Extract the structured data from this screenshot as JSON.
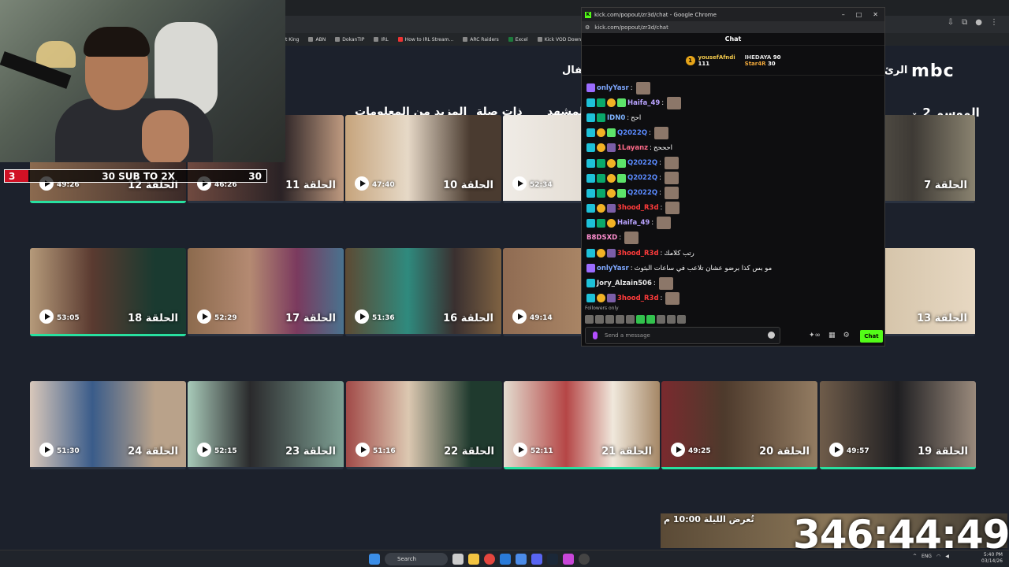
{
  "browser": {
    "bookmarks": [
      "t King",
      "ABN",
      "DokanTIP",
      "IRL",
      "How to IRL Stream...",
      "ARC Raiders",
      "Excel",
      "Kick VOD Download..."
    ]
  },
  "site": {
    "logo": "mbc",
    "nav_right": "الرئ",
    "nav_left": "أطفال",
    "tabs": [
      "المزيد من المعلومات",
      "ذات صلة",
      "المشهد"
    ],
    "season": "الموسم 2"
  },
  "episodes": [
    {
      "title": "الحلقة 7",
      "duration": ""
    },
    {
      "title": "الحلقة 10",
      "duration": "47:40"
    },
    {
      "title": "الحلقة 11",
      "duration": "46:26"
    },
    {
      "title": "الحلقة 12",
      "duration": "49:26"
    },
    {
      "title": "",
      "duration": "52:34"
    },
    {
      "title": "الحلقة 13",
      "duration": ""
    },
    {
      "title": "",
      "duration": "49:14"
    },
    {
      "title": "الحلقة 16",
      "duration": "51:36"
    },
    {
      "title": "الحلقة 17",
      "duration": "52:29"
    },
    {
      "title": "الحلقة 18",
      "duration": "53:05"
    },
    {
      "title": "الحلقة 19",
      "duration": "49:57"
    },
    {
      "title": "الحلقة 20",
      "duration": "49:25"
    },
    {
      "title": "الحلقة 21",
      "duration": "52:11"
    },
    {
      "title": "الحلقة 22",
      "duration": "51:16"
    },
    {
      "title": "الحلقة 23",
      "duration": "52:15"
    },
    {
      "title": "الحلقة 24",
      "duration": "51:30"
    }
  ],
  "sub_goal": {
    "current": "3",
    "label": "30 SUB TO 2X",
    "target": "30"
  },
  "chat_window": {
    "title": "kick.com/popout/zr3d/chat - Google Chrome",
    "url": "kick.com/popout/zr3d/chat",
    "header": "Chat",
    "pinned": [
      {
        "name": "yousefAfndi",
        "value": "111"
      },
      {
        "name": "IHEDAYA",
        "value": "90"
      },
      {
        "name": "Star4R",
        "value": "30"
      }
    ],
    "messages": [
      {
        "user": "onlyYasr",
        "text": "",
        "color": "#7fa8ff"
      },
      {
        "user": "Haifa_49",
        "text": "",
        "color": "#b9a3ff"
      },
      {
        "user": "IDN0",
        "text": "احح",
        "color": "#7fb4ff"
      },
      {
        "user": "Q2022Q",
        "text": "",
        "color": "#5b8bff"
      },
      {
        "user": "1Layanz",
        "text": "احححح",
        "color": "#ff6b8a"
      },
      {
        "user": "Q2022Q",
        "text": "",
        "color": "#5b8bff"
      },
      {
        "user": "Q2022Q",
        "text": "",
        "color": "#5b8bff"
      },
      {
        "user": "Q2022Q",
        "text": "",
        "color": "#5b8bff"
      },
      {
        "user": "3hood_R3d",
        "text": "",
        "color": "#ff3b3b"
      },
      {
        "user": "Haifa_49",
        "text": "",
        "color": "#b9a3ff"
      },
      {
        "user": "B8DSXD",
        "text": "",
        "color": "#ff8fd0"
      },
      {
        "user": "3hood_R3d",
        "text": "رتب كلامك",
        "color": "#ff3b3b"
      },
      {
        "user": "onlyYasr",
        "text": "مو بس كذا برضو عشان تلاعب في ساعات البثوث",
        "color": "#7fa8ff"
      },
      {
        "user": "Jory_Alzain506",
        "text": "",
        "color": "#e6e6e6"
      },
      {
        "user": "3hood_R3d",
        "text": "",
        "color": "#ff3b3b"
      }
    ],
    "followers_label": "Followers only",
    "input_placeholder": "Send a message",
    "send_label": "Chat"
  },
  "promo": {
    "text": "تُعرض الليلة 10:00 م"
  },
  "timer": "346:44:49",
  "taskbar": {
    "search": "Search",
    "lang": "ENG",
    "time": "5:40 PM",
    "date": "03/14/26"
  }
}
